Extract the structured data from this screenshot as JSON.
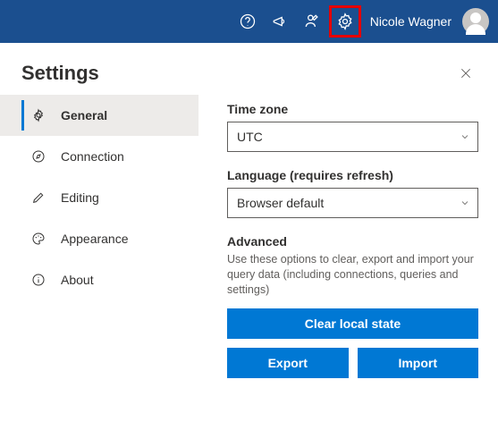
{
  "topbar": {
    "username": "Nicole Wagner"
  },
  "panel": {
    "title": "Settings"
  },
  "sidebar": {
    "items": [
      {
        "label": "General"
      },
      {
        "label": "Connection"
      },
      {
        "label": "Editing"
      },
      {
        "label": "Appearance"
      },
      {
        "label": "About"
      }
    ]
  },
  "content": {
    "timezone_label": "Time zone",
    "timezone_value": "UTC",
    "language_label": "Language (requires refresh)",
    "language_value": "Browser default",
    "advanced_title": "Advanced",
    "advanced_help": "Use these options to clear, export and import your query data (including connections, queries and settings)",
    "clear_label": "Clear local state",
    "export_label": "Export",
    "import_label": "Import"
  }
}
